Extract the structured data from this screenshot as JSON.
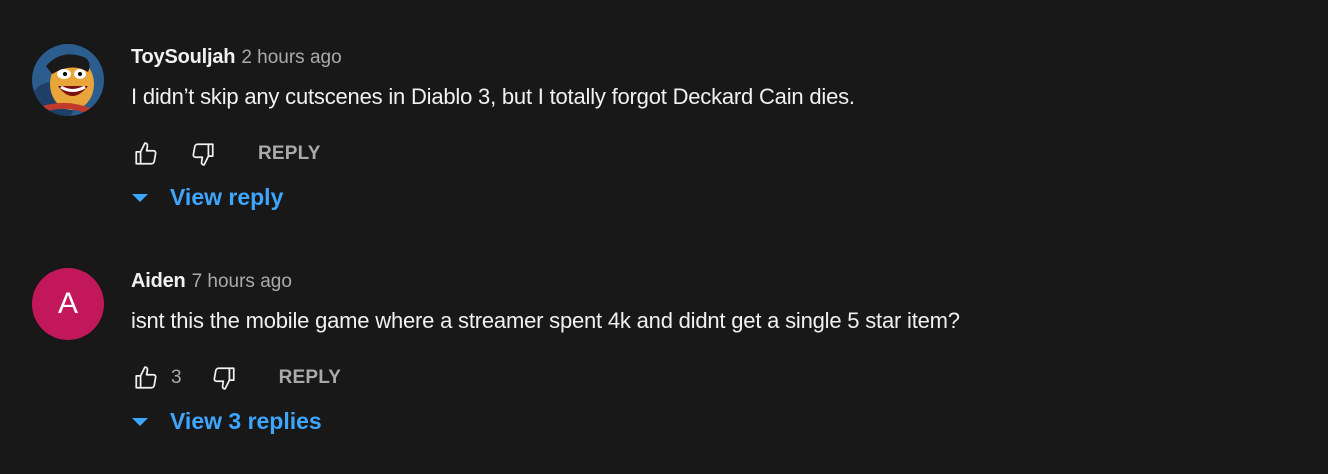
{
  "comments": [
    {
      "author": "ToySouljah",
      "time": "2 hours ago",
      "text": "I didn’t skip any cutscenes in Diablo 3, but I totally forgot Deckard Cain dies.",
      "likes": "",
      "reply_label": "REPLY",
      "view_replies_label": "View reply",
      "avatar": {
        "type": "image",
        "icon": "cartoon-face-avatar"
      }
    },
    {
      "author": "Aiden",
      "time": "7 hours ago",
      "text": "isnt this the mobile game where a streamer spent 4k and didnt get a single 5 star item?",
      "likes": "3",
      "reply_label": "REPLY",
      "view_replies_label": "View 3 replies",
      "avatar": {
        "type": "letter",
        "letter": "A",
        "color": "#c2185b"
      }
    }
  ],
  "colors": {
    "background": "#181818",
    "primary_text": "#f1f1f1",
    "secondary_text": "#aaaaaa",
    "link": "#3ea6ff"
  }
}
